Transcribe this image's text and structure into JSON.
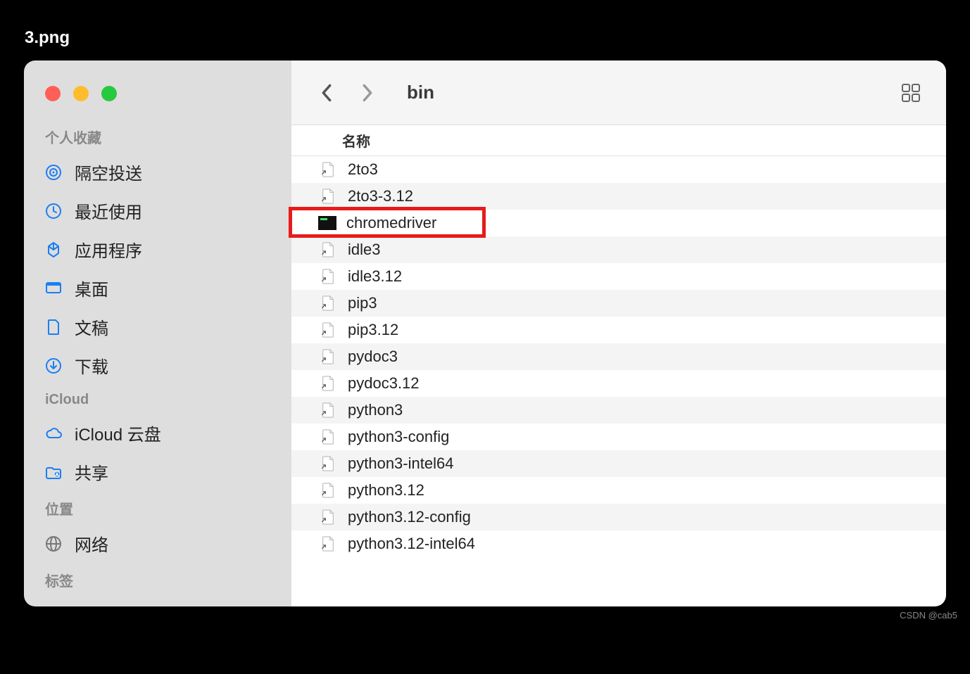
{
  "tabTitle": "3.png",
  "toolbar": {
    "folder": "bin"
  },
  "columnHeader": "名称",
  "sidebar": {
    "sections": [
      {
        "label": "个人收藏",
        "items": [
          {
            "icon": "airdrop",
            "label": "隔空投送"
          },
          {
            "icon": "clock",
            "label": "最近使用"
          },
          {
            "icon": "apps",
            "label": "应用程序"
          },
          {
            "icon": "desktop",
            "label": "桌面"
          },
          {
            "icon": "doc",
            "label": "文稿"
          },
          {
            "icon": "download",
            "label": "下载"
          }
        ]
      },
      {
        "label": "iCloud",
        "items": [
          {
            "icon": "cloud",
            "label": "iCloud 云盘"
          },
          {
            "icon": "shared",
            "label": "共享"
          }
        ]
      },
      {
        "label": "位置",
        "items": [
          {
            "icon": "network",
            "label": "网络"
          }
        ]
      },
      {
        "label": "标签",
        "items": []
      }
    ]
  },
  "files": [
    {
      "name": "2to3",
      "type": "alias"
    },
    {
      "name": "2to3-3.12",
      "type": "alias"
    },
    {
      "name": "chromedriver",
      "type": "exec",
      "highlight": true
    },
    {
      "name": "idle3",
      "type": "alias"
    },
    {
      "name": "idle3.12",
      "type": "alias"
    },
    {
      "name": "pip3",
      "type": "alias"
    },
    {
      "name": "pip3.12",
      "type": "alias"
    },
    {
      "name": "pydoc3",
      "type": "alias"
    },
    {
      "name": "pydoc3.12",
      "type": "alias"
    },
    {
      "name": "python3",
      "type": "alias"
    },
    {
      "name": "python3-config",
      "type": "alias"
    },
    {
      "name": "python3-intel64",
      "type": "alias"
    },
    {
      "name": "python3.12",
      "type": "alias"
    },
    {
      "name": "python3.12-config",
      "type": "alias"
    },
    {
      "name": "python3.12-intel64",
      "type": "alias"
    }
  ],
  "watermark": "CSDN @cab5"
}
